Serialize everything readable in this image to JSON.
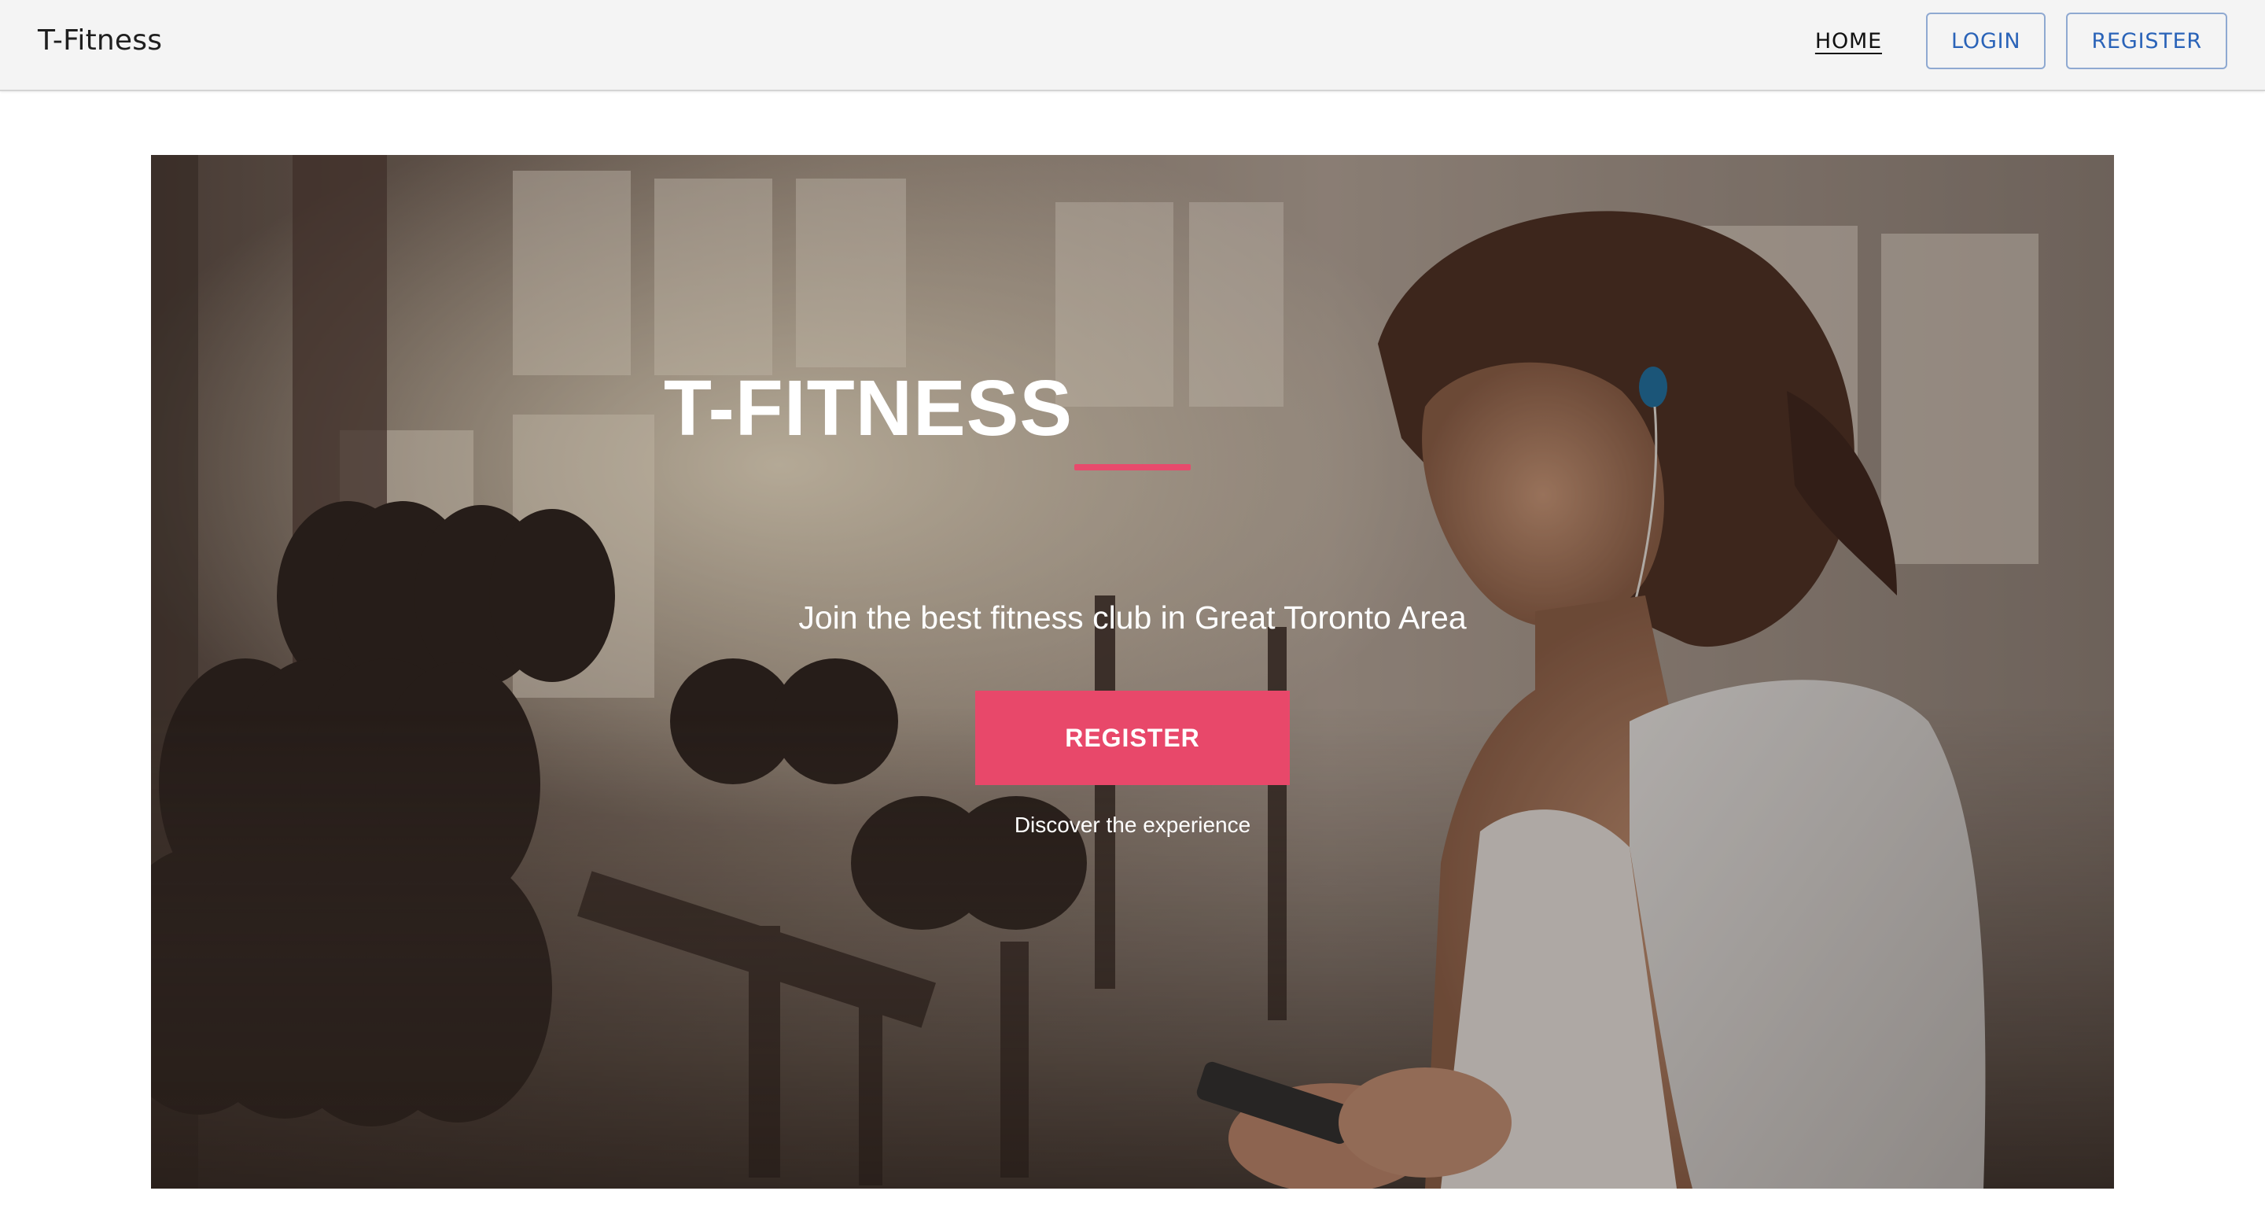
{
  "header": {
    "brand": "T-Fitness",
    "nav": {
      "home_label": "HOME",
      "login_label": "LOGIN",
      "register_label": "REGISTER"
    }
  },
  "hero": {
    "title": "T-FITNESS",
    "tagline": "Join the best fitness club in Great Toronto Area",
    "cta_label": "REGISTER",
    "subtext": "Discover the experience"
  },
  "colors": {
    "accent": "#e8486a",
    "nav_button_text": "#2a63b8",
    "appbar_bg": "#f4f4f4"
  }
}
